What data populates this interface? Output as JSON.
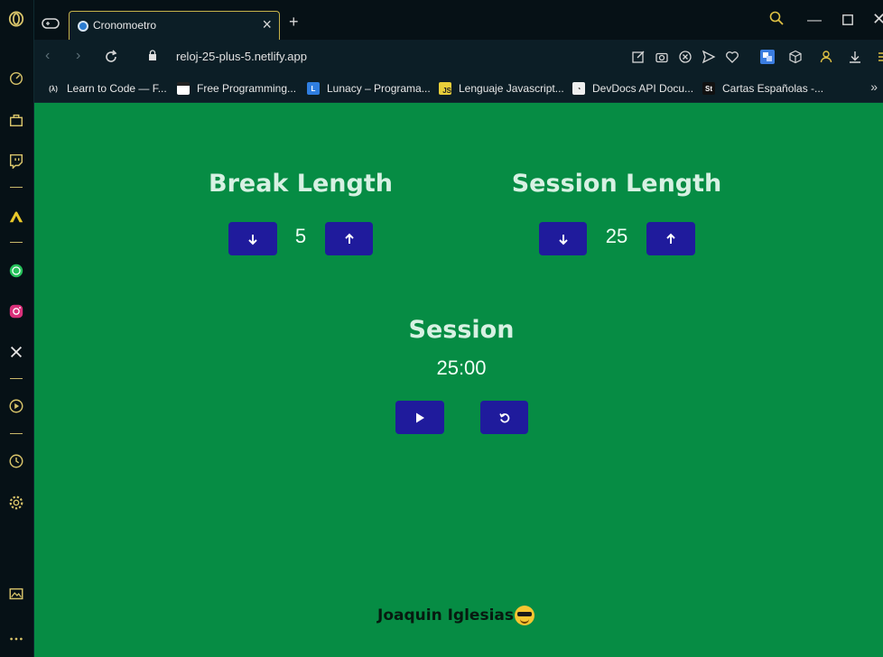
{
  "browser": {
    "tab_title": "Cronomoetro",
    "url_text": "reloj-25-plus-5.netlify.app",
    "bookmarks": [
      {
        "label": "Learn to Code — F...",
        "icon": "freecodecamp-icon"
      },
      {
        "label": "Free Programming...",
        "icon": "bookmark-favicon-icon"
      },
      {
        "label": "Lunacy – Programa...",
        "icon": "lunacy-icon"
      },
      {
        "label": "Lenguaje Javascript...",
        "icon": "js-icon"
      },
      {
        "label": "DevDocs API Docu...",
        "icon": "devdocs-icon"
      },
      {
        "label": "Cartas Españolas -...",
        "icon": "st-icon"
      }
    ],
    "bm_fav_text": {
      "fcc": "(λ)",
      "js": "JS",
      "st": "St"
    }
  },
  "app": {
    "break": {
      "heading": "Break Length",
      "value": "5"
    },
    "session_length": {
      "heading": "Session Length",
      "value": "25"
    },
    "timer": {
      "label": "Session",
      "time": "25:00"
    },
    "author": "Joaquin Iglesias"
  },
  "colors": {
    "page_bg": "#068c44",
    "button_bg": "#1f1b9c",
    "heading_text": "#d7f1e3",
    "tab_accent": "#c7b24a"
  }
}
